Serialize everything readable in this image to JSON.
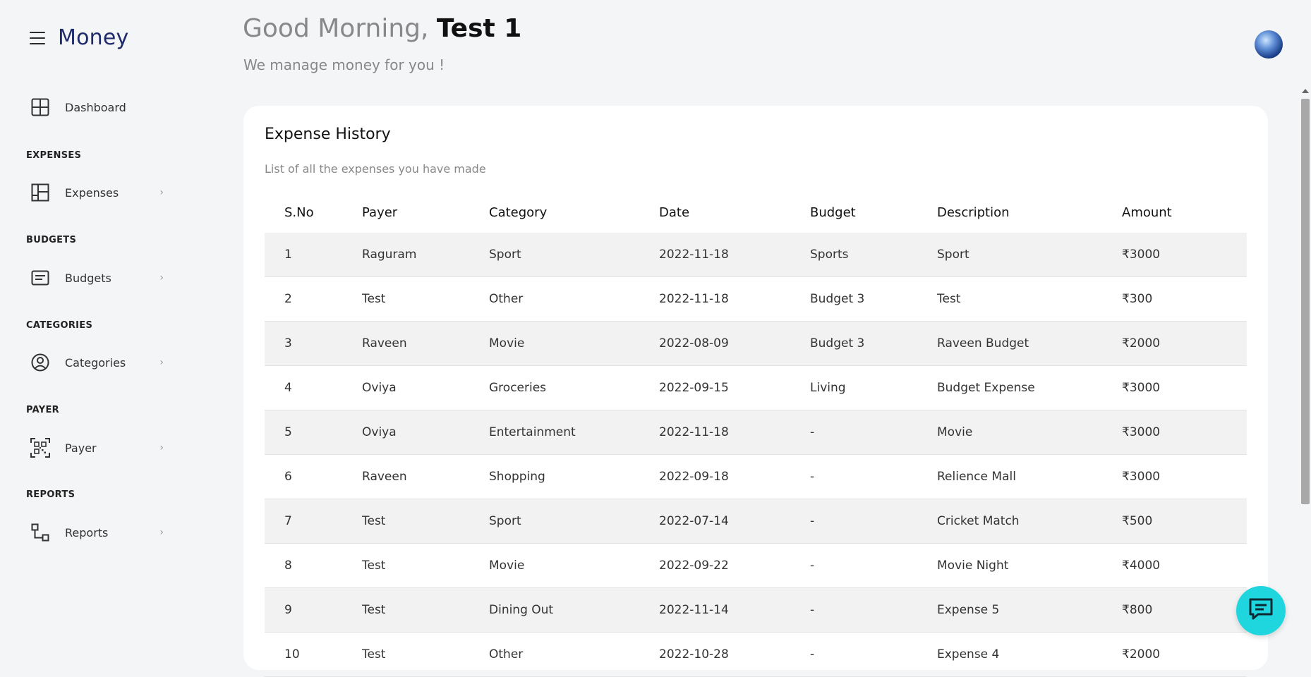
{
  "app": {
    "brand": "Money"
  },
  "sidebar": {
    "dashboard": {
      "label": "Dashboard",
      "icon": "grid-icon"
    },
    "sections": [
      {
        "title": "EXPENSES",
        "item": {
          "label": "Expenses",
          "icon": "layout-icon"
        }
      },
      {
        "title": "BUDGETS",
        "item": {
          "label": "Budgets",
          "icon": "list-box-icon"
        }
      },
      {
        "title": "CATEGORIES",
        "item": {
          "label": "Categories",
          "icon": "user-circle-icon"
        }
      },
      {
        "title": "PAYER",
        "item": {
          "label": "Payer",
          "icon": "qr-code-icon"
        }
      },
      {
        "title": "REPORTS",
        "item": {
          "label": "Reports",
          "icon": "flow-icon"
        }
      }
    ],
    "chevron": "›"
  },
  "header": {
    "greeting_prefix": "Good Morning,",
    "user_name": "Test 1",
    "subtitle": "We manage money for you !"
  },
  "expense_history": {
    "title": "Expense History",
    "subtitle": "List of all the expenses you have made",
    "columns": [
      "S.No",
      "Payer",
      "Category",
      "Date",
      "Budget",
      "Description",
      "Amount"
    ],
    "rows": [
      [
        "1",
        "Raguram",
        "Sport",
        "2022-11-18",
        "Sports",
        "Sport",
        "₹3000"
      ],
      [
        "2",
        "Test",
        "Other",
        "2022-11-18",
        "Budget 3",
        "Test",
        "₹300"
      ],
      [
        "3",
        "Raveen",
        "Movie",
        "2022-08-09",
        "Budget 3",
        "Raveen Budget",
        "₹2000"
      ],
      [
        "4",
        "Oviya",
        "Groceries",
        "2022-09-15",
        "Living",
        "Budget Expense",
        "₹3000"
      ],
      [
        "5",
        "Oviya",
        "Entertainment",
        "2022-11-18",
        "-",
        "Movie",
        "₹3000"
      ],
      [
        "6",
        "Raveen",
        "Shopping",
        "2022-09-18",
        "-",
        "Relience Mall",
        "₹3000"
      ],
      [
        "7",
        "Test",
        "Sport",
        "2022-07-14",
        "-",
        "Cricket Match",
        "₹500"
      ],
      [
        "8",
        "Test",
        "Movie",
        "2022-09-22",
        "-",
        "Movie Night",
        "₹4000"
      ],
      [
        "9",
        "Test",
        "Dining Out",
        "2022-11-14",
        "-",
        "Expense 5",
        "₹800"
      ],
      [
        "10",
        "Test",
        "Other",
        "2022-10-28",
        "-",
        "Expense 4",
        "₹2000"
      ]
    ]
  },
  "colors": {
    "brand": "#1f2a6b",
    "chat_button": "#1fd6df",
    "row_stripe": "#f2f2f2"
  }
}
